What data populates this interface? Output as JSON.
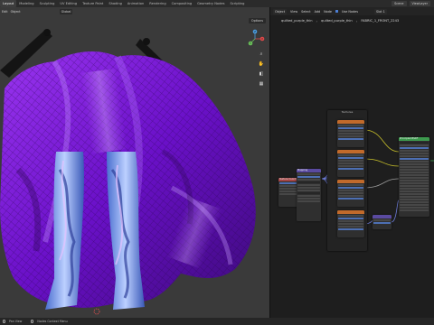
{
  "app": {
    "workspace_tabs": [
      "Layout",
      "Modeling",
      "Sculpting",
      "UV Editing",
      "Texture Paint",
      "Shading",
      "Animation",
      "Rendering",
      "Compositing",
      "Geometry Nodes",
      "Scripting"
    ],
    "active_tab_index": 0,
    "scene_label": "Scene",
    "view_layer_label": "ViewLayer"
  },
  "viewport": {
    "header": {
      "edit_menu": "Edit",
      "object_menu": "Object",
      "transform_orientation": "Global"
    },
    "options_label": "Options",
    "gizmo_axes": {
      "x": "X",
      "y": "Y",
      "z": "Z"
    }
  },
  "node_editor": {
    "header": {
      "object_dropdown": "Object",
      "view_menu": "View",
      "select_menu": "Select",
      "add_menu": "Add",
      "node_menu": "Node",
      "use_nodes_label": "Use Nodes",
      "slot_label": "Slot 1"
    },
    "breadcrumbs": [
      "quilted_purple_thin",
      "quilted_purple_thin",
      "FABRIC_1_FRONT_2243"
    ],
    "node_titles": {
      "mapping": "Mapping",
      "texcoord": "Texture Coordinate",
      "textures_frame": "Textures",
      "principled": "Principled BSDF"
    },
    "colors": {
      "texture_header": "#c16a2b",
      "bsdf_header": "#3d9a4e",
      "vector_header": "#5a4aa0",
      "fabric": "#7b1fd6",
      "wire_yellow": "#c8c02a",
      "wire_blue": "#6d7bd6",
      "wire_grey": "#9a9a9a"
    }
  },
  "statusbar": {
    "hint_1": "Pan View",
    "hint_2": "Nodes Context Menu"
  }
}
